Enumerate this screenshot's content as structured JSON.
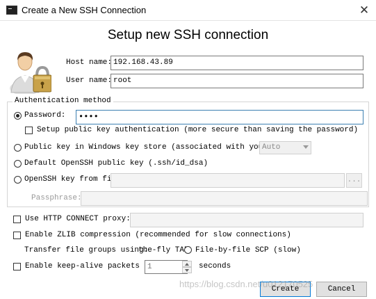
{
  "window": {
    "title": "Create a New SSH Connection",
    "close_glyph": "✕"
  },
  "heading": "Setup new SSH connection",
  "host": {
    "label": "Host name:",
    "value": "192.168.43.89"
  },
  "user": {
    "label": "User name:",
    "value": "root"
  },
  "auth": {
    "legend": "Authentication method",
    "password_label": "Password:",
    "password_value": "••••",
    "setup_public_key_label": "Setup public key authentication (more secure than saving the password)",
    "windows_key_store_label": "Public key in Windows key store (associated with your us",
    "windows_key_store_combo": "Auto",
    "default_openssh_label": "Default OpenSSH public key (.ssh/id_dsa)",
    "openssh_file_label": "OpenSSH key from file:",
    "browse_label": "...",
    "passphrase_label": "Passphrase:"
  },
  "options": {
    "proxy_label": "Use HTTP CONNECT proxy:",
    "zlib_label": "Enable ZLIB compression (recommended for slow connections)",
    "transfer_label": "Transfer file groups using:",
    "onthefly_label": "the-fly TAR",
    "filebyfile_label": "File-by-file SCP (slow)",
    "keepalive_label": "Enable keep-alive packets eve",
    "keepalive_value": "1",
    "seconds_label": "seconds"
  },
  "buttons": {
    "create": "Create",
    "cancel": "Cancel"
  },
  "watermark": "https://blog.csdn.net/u012170525",
  "colors": {
    "accent": "#0078d7",
    "focus_border": "#3c7fb1"
  },
  "icons": {
    "app": "terminal-icon",
    "user_lock": "user-lock-icon",
    "close": "close-icon"
  }
}
